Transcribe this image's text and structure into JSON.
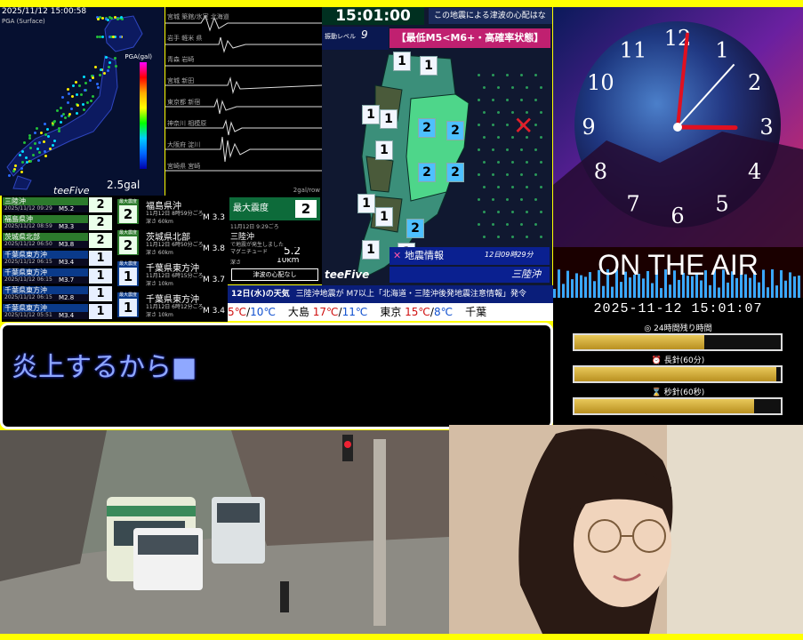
{
  "map": {
    "timestamp": "2025/11/12 15:00:58",
    "header": "PGA (Surface)",
    "pga_label": "PGA(gal)",
    "gal": "2.5gal",
    "watermark": "teeFive",
    "dot_colors": [
      "#2a6bff",
      "#22c03a",
      "#22c03a",
      "#00ddff",
      "#ffee00"
    ]
  },
  "waves": {
    "stations": [
      "宮城 築館/氷室 北海道",
      "岩手 軽米 県",
      "青森 岩崎",
      "宮城 新田",
      "東京都 新宿",
      "神奈川 相模原",
      "大阪府 淀川",
      "宮崎県 宮崎"
    ],
    "footer": "2gal/row"
  },
  "intensity": {
    "time": "15:01:00",
    "tsunami": "この地震による津波の心配はなし",
    "level_label": "振動レベル",
    "level_value": "9",
    "banner": "【最低M5<M6+・高確率状態】",
    "epicenter_mark": "✕",
    "shindo": [
      {
        "v": "1",
        "cls": "s1"
      },
      {
        "v": "1",
        "cls": "s1"
      },
      {
        "v": "1",
        "cls": "s1"
      },
      {
        "v": "1",
        "cls": "s1"
      },
      {
        "v": "2",
        "cls": "s2"
      },
      {
        "v": "2",
        "cls": "s2"
      },
      {
        "v": "2",
        "cls": "s2"
      },
      {
        "v": "2",
        "cls": "s2"
      },
      {
        "v": "1",
        "cls": "s1"
      },
      {
        "v": "1",
        "cls": "s1"
      },
      {
        "v": "1",
        "cls": "s1"
      },
      {
        "v": "2",
        "cls": "s2"
      },
      {
        "v": "1",
        "cls": "s1"
      },
      {
        "v": "1",
        "cls": "s1"
      }
    ],
    "info_title": "地震情報",
    "info_time": "12日09時29分",
    "info_place": "三陸沖",
    "watermark": "teeFive"
  },
  "clock": {
    "numbers": [
      "12",
      "1",
      "2",
      "3",
      "4",
      "5",
      "6",
      "7",
      "8",
      "9",
      "10",
      "11"
    ],
    "hour": 15,
    "minute": 1,
    "second": 7,
    "onair": "ON THE AIR"
  },
  "quake_list": [
    {
      "place": "三陸沖",
      "date": "2025/11/12 09:29",
      "mag": "M5.2",
      "shindo": "2",
      "color": "g"
    },
    {
      "place": "福島県沖",
      "date": "2025/11/12 08:59",
      "mag": "M3.3",
      "shindo": "2",
      "color": "g"
    },
    {
      "place": "茨城県北部",
      "date": "2025/11/12 06:50",
      "mag": "M3.8",
      "shindo": "2",
      "color": "g"
    },
    {
      "place": "千葉県東方沖",
      "date": "2025/11/12 06:15",
      "mag": "M3.4",
      "shindo": "1",
      "color": "b"
    },
    {
      "place": "千葉県東方沖",
      "date": "2025/11/12 06:15",
      "mag": "M3.7",
      "shindo": "1",
      "color": "b"
    },
    {
      "place": "千葉県東方沖",
      "date": "2025/11/12 06:15",
      "mag": "M2.8",
      "shindo": "1",
      "color": "b"
    },
    {
      "place": "千葉県東方沖",
      "date": "2025/11/12 05:51",
      "mag": "M3.4",
      "shindo": "1",
      "color": "b"
    }
  ],
  "cards": [
    {
      "badge_title": "最大震度",
      "shindo": "2",
      "name": "福島県沖",
      "date": "11月12日 8時59分ごろ",
      "depth": "深さ 60km",
      "mag": "M 3.3",
      "color": "g"
    },
    {
      "badge_title": "最大震度",
      "shindo": "2",
      "name": "茨城県北部",
      "date": "11月12日 6時50分ごろ",
      "depth": "深さ 60km",
      "mag": "M 3.8",
      "color": "g"
    },
    {
      "badge_title": "最大震度",
      "shindo": "1",
      "name": "千葉県東方沖",
      "date": "11月12日 6時15分ごろ",
      "depth": "深さ 10km",
      "mag": "M 3.7",
      "color": "b"
    },
    {
      "badge_title": "最大震度",
      "shindo": "1",
      "name": "千葉県東方沖",
      "date": "11月12日 6時12分ごろ",
      "depth": "深さ 10km",
      "mag": "M 3.4",
      "color": "b"
    }
  ],
  "detail": {
    "max_label": "最大震度",
    "max_value": "2",
    "date": "11月12日 9:29ごろ",
    "place": "三陸沖",
    "note": "で地震が発生しました",
    "mag_label": "マグニチュード",
    "mag_value": "5.2",
    "depth_label": "深さ",
    "depth_value": "10km",
    "tsunami": "津波の心配なし"
  },
  "weather": {
    "day": "12日(水)の天気",
    "news": "三陸沖地震が M7以上「北海道・三陸沖後発地震注意情報」発令",
    "items": [
      {
        "city": "",
        "hi": "5℃",
        "lo": "10℃"
      },
      {
        "city": "大島",
        "hi": "17℃",
        "lo": "11℃"
      },
      {
        "city": "東京",
        "hi": "15℃",
        "lo": "8℃"
      },
      {
        "city": "千葉",
        "hi": "",
        "lo": ""
      }
    ]
  },
  "chat": {
    "text": "炎上するから■"
  },
  "status": {
    "datetime": "2025-11-12 15:01:07",
    "bars": [
      {
        "label": "◎ 24時間残り時間",
        "fill": 0.63
      },
      {
        "label": "⏰ 長針(60分)",
        "fill": 0.98
      },
      {
        "label": "⌛ 秒針(60秒)",
        "fill": 0.87
      }
    ]
  }
}
